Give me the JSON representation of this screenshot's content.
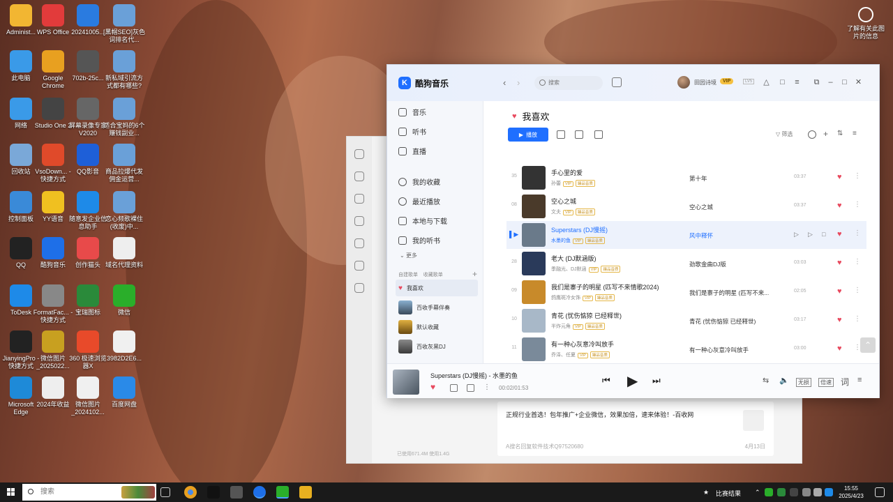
{
  "desktop": {
    "icons": [
      {
        "label": "Administ...",
        "icon": "folder-user-icon",
        "color": "#f2b632"
      },
      {
        "label": "WPS Office",
        "icon": "wps-icon",
        "color": "#e23b3b"
      },
      {
        "label": "20241005...",
        "icon": "image-icon",
        "color": "#2a7be0"
      },
      {
        "label": "[黑帽SEO]灰色词排名代...",
        "icon": "video-file-icon",
        "color": "#6aa0d8"
      },
      {
        "label": "此电脑",
        "icon": "computer-icon",
        "color": "#3a9ae8"
      },
      {
        "label": "Google Chrome",
        "icon": "chrome-icon",
        "color": "#e8a020"
      },
      {
        "label": "702b-25c...",
        "icon": "image-icon",
        "color": "#555555"
      },
      {
        "label": "新私域引流方式都有哪些?",
        "icon": "video-file-icon",
        "color": "#6aa0d8"
      },
      {
        "label": "网络",
        "icon": "network-icon",
        "color": "#3a9ae8"
      },
      {
        "label": "Studio One 2",
        "icon": "studio-one-icon",
        "color": "#444444"
      },
      {
        "label": "屏幕录像专家V2020",
        "icon": "screen-recorder-icon",
        "color": "#666666"
      },
      {
        "label": "适合宝妈的6个赚钱副业...",
        "icon": "video-file-icon",
        "color": "#6aa0d8"
      },
      {
        "label": "回收站",
        "icon": "recycle-bin-icon",
        "color": "#7aa8d8"
      },
      {
        "label": "VsoDown... - 快捷方式",
        "icon": "vso-icon",
        "color": "#e04a2a"
      },
      {
        "label": "QQ影音",
        "icon": "qq-player-icon",
        "color": "#1e5fd8"
      },
      {
        "label": "商品拉爆代发佣金运营...",
        "icon": "video-file-icon",
        "color": "#6aa0d8"
      },
      {
        "label": "控制面板",
        "icon": "control-panel-icon",
        "color": "#3a8ad8"
      },
      {
        "label": "YY语音",
        "icon": "yy-icon",
        "color": "#f0c020"
      },
      {
        "label": "随意发企业信息助手",
        "icon": "s-app-icon",
        "color": "#1e8ae8"
      },
      {
        "label": "恋心频歌裸住(收废)中...",
        "icon": "video-file-icon",
        "color": "#6aa0d8"
      },
      {
        "label": "QQ",
        "icon": "qq-icon",
        "color": "#222222"
      },
      {
        "label": "酷狗音乐",
        "icon": "kugou-icon",
        "color": "#1e6fe8"
      },
      {
        "label": "创作猫头",
        "icon": "creator-icon",
        "color": "#e84a4a"
      },
      {
        "label": "域名代理资料",
        "icon": "document-icon",
        "color": "#eeeeee"
      },
      {
        "label": "ToDesk",
        "icon": "todesk-icon",
        "color": "#1e8ae8"
      },
      {
        "label": "FormatFac... - 快捷方式",
        "icon": "format-factory-icon",
        "color": "#888888"
      },
      {
        "label": "宝瑞图标",
        "icon": "bt-icon",
        "color": "#2a8a3a"
      },
      {
        "label": "微信",
        "icon": "wechat-icon",
        "color": "#2aae2a"
      },
      {
        "label": "JianyingPro - 快捷方式",
        "icon": "jianying-icon",
        "color": "#222222"
      },
      {
        "label": "微信图片_2025022...",
        "icon": "image-icon",
        "color": "#c8a020"
      },
      {
        "label": "360 极速浏览器X",
        "icon": "360-browser-icon",
        "color": "#e84a2a"
      },
      {
        "label": "3982D2E6...",
        "icon": "image-icon",
        "color": "#f0f0f0"
      },
      {
        "label": "Microsoft Edge",
        "icon": "edge-icon",
        "color": "#1e8ad8"
      },
      {
        "label": "2024年收益",
        "icon": "document-icon",
        "color": "#eeeeee"
      },
      {
        "label": "微信图片_2024102...",
        "icon": "image-icon",
        "color": "#f0f0f0"
      },
      {
        "label": "百度网盘",
        "icon": "baidu-disk-icon",
        "color": "#2a8ae8"
      }
    ],
    "top_right_widget": "了解有关此图片的信息"
  },
  "back_window": {
    "message": "正规行业首选！包年推广+企业微信，效果加倍，速来体验！-百收网",
    "sub": "A搜名回复软件技术Q97520680",
    "date": "4月13日",
    "footer": "已使用671.4M 使用1.4G"
  },
  "player": {
    "app_name": "酷狗音乐",
    "logo_letter": "K",
    "search_placeholder": "搜索",
    "username": "田园诗境",
    "vip_label": "VIP",
    "level": "LV5",
    "sidebar": {
      "nav": [
        "音乐",
        "听书",
        "直播"
      ],
      "library": [
        "我的收藏",
        "最近播放",
        "本地与下载",
        "我的听书"
      ],
      "more": "更多",
      "tab_created": "自建歌单",
      "tab_collected": "收藏歌单",
      "playlists": [
        "我喜欢",
        "百收手幕伴奏",
        "默认收藏",
        "百收灰黑DJ"
      ]
    },
    "page_title": "我喜欢",
    "play_all": "播放",
    "filter": "筛选",
    "songs": [
      {
        "index": "35",
        "title": "手心里的爱",
        "artist": "孙蕾",
        "album": "第十年",
        "duration": "03:37",
        "cover": "#333333"
      },
      {
        "index": "08",
        "title": "空心之城",
        "artist": "文夫",
        "album": "空心之城",
        "duration": "03:37",
        "cover": "#4a3a2a"
      },
      {
        "index": "",
        "title": "Superstars (DJ慢摇)",
        "artist": "水墨的鱼",
        "album": "风中释怀",
        "duration": "",
        "cover": "#6a7a8a",
        "active": true
      },
      {
        "index": "28",
        "title": "老大 (DJ默涵版)",
        "artist": "季融光、DJ默涵",
        "album": "劲歌金曲DJ版",
        "duration": "03:03",
        "cover": "#2a3a5a"
      },
      {
        "index": "09",
        "title": "我们是寨子的明星 (匹写不来情歌2024)",
        "artist": "鸽鹰斑冷女饰",
        "album": "我们是寨子的明星 (匹写不来...",
        "duration": "02:05",
        "cover": "#c88a2a"
      },
      {
        "index": "10",
        "title": "青花 (忧伤惦猄 已经释世)",
        "artist": "半炸元角",
        "album": "青花 (忧伤惦猄 已经释世)",
        "duration": "03:17",
        "cover": "#a8b8c8"
      },
      {
        "index": "11",
        "title": "有一种心灰意冷叫放手",
        "artist": "乔泽、任夏",
        "album": "有一种心灰意冷叫放手",
        "duration": "03:00",
        "cover": "#7a8a9a"
      }
    ],
    "tag_vip": "VIP",
    "tag_quality": "臻品音质",
    "now_playing": {
      "title": "Superstars (DJ慢摇) - 水墨的鱼",
      "time": "00:02/01:53",
      "badge_sq": "无损",
      "badge_speed": "倍速",
      "lyrics": "词"
    }
  },
  "taskbar": {
    "search_placeholder": "搜索",
    "tray_label": "比赛结果",
    "time": "15:55",
    "date": "2025/4/23"
  }
}
